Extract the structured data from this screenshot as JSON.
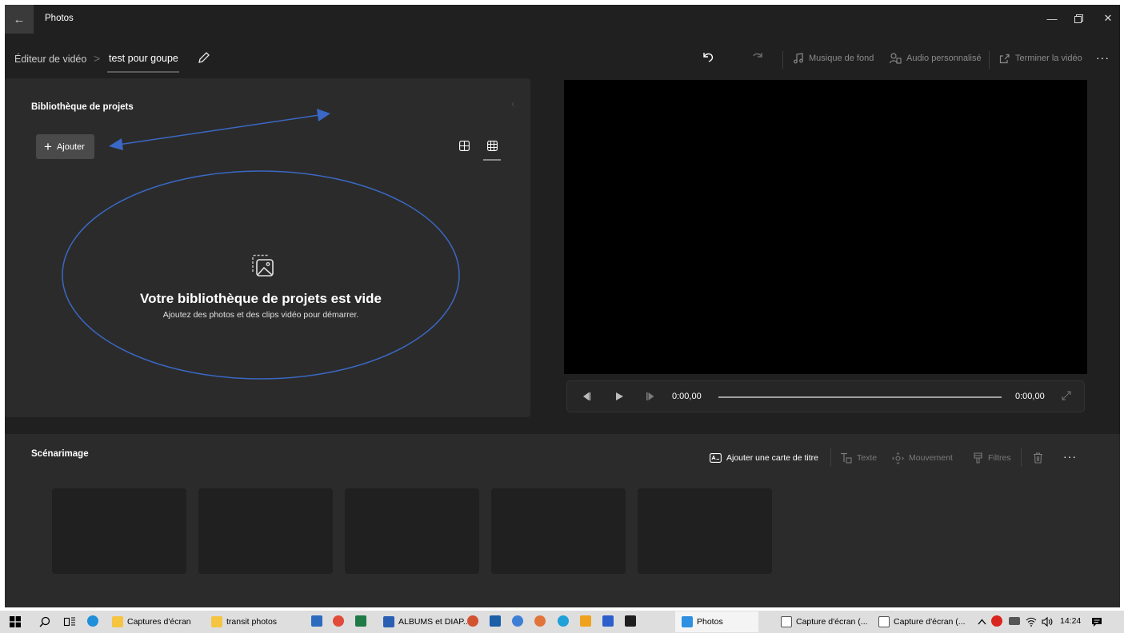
{
  "window": {
    "app_title": "Photos",
    "back_icon": "back-arrow-icon",
    "controls": [
      "minimize-icon",
      "restore-icon",
      "close-icon"
    ]
  },
  "command_bar": {
    "breadcrumb_parent": "Éditeur de vidéo",
    "breadcrumb_separator": ">",
    "project_name": "test pour goupe",
    "background_music_label": "Musique de fond",
    "custom_audio_label": "Audio personnalisé",
    "finish_video_label": "Terminer la vidéo",
    "more_label": "···"
  },
  "library": {
    "title": "Bibliothèque de projets",
    "add_label": "Ajouter",
    "empty_title": "Votre bibliothèque de projets est vide",
    "empty_subtitle": "Ajoutez des photos et des clips vidéo pour démarrer."
  },
  "player": {
    "current_time": "0:00,00",
    "total_time": "0:00,00",
    "progress": 0
  },
  "storyboard": {
    "title": "Scénarimage",
    "add_title_card_label": "Ajouter une carte de titre",
    "text_label": "Texte",
    "motion_label": "Mouvement",
    "filters_label": "Filtres",
    "more_label": "···",
    "empty_slots": 5
  },
  "annotations": {
    "color": "#3a68c4",
    "arrow": "double-headed arrow pointing to Ajouter button",
    "ellipse": "circle around empty library message"
  },
  "taskbar": {
    "items": [
      {
        "label": "Captures d'écran",
        "icon": "folder-icon"
      },
      {
        "label": "transit photos",
        "icon": "folder-icon"
      },
      {
        "label": "ALBUMS et DIAP...",
        "icon": "word-icon"
      },
      {
        "label": "Photos",
        "icon": "photos-icon"
      },
      {
        "label": "Capture d'écran (...",
        "icon": "screenshot-icon"
      },
      {
        "label": "Capture d'écran (...",
        "icon": "screenshot-icon"
      }
    ],
    "clock": "14:24"
  }
}
